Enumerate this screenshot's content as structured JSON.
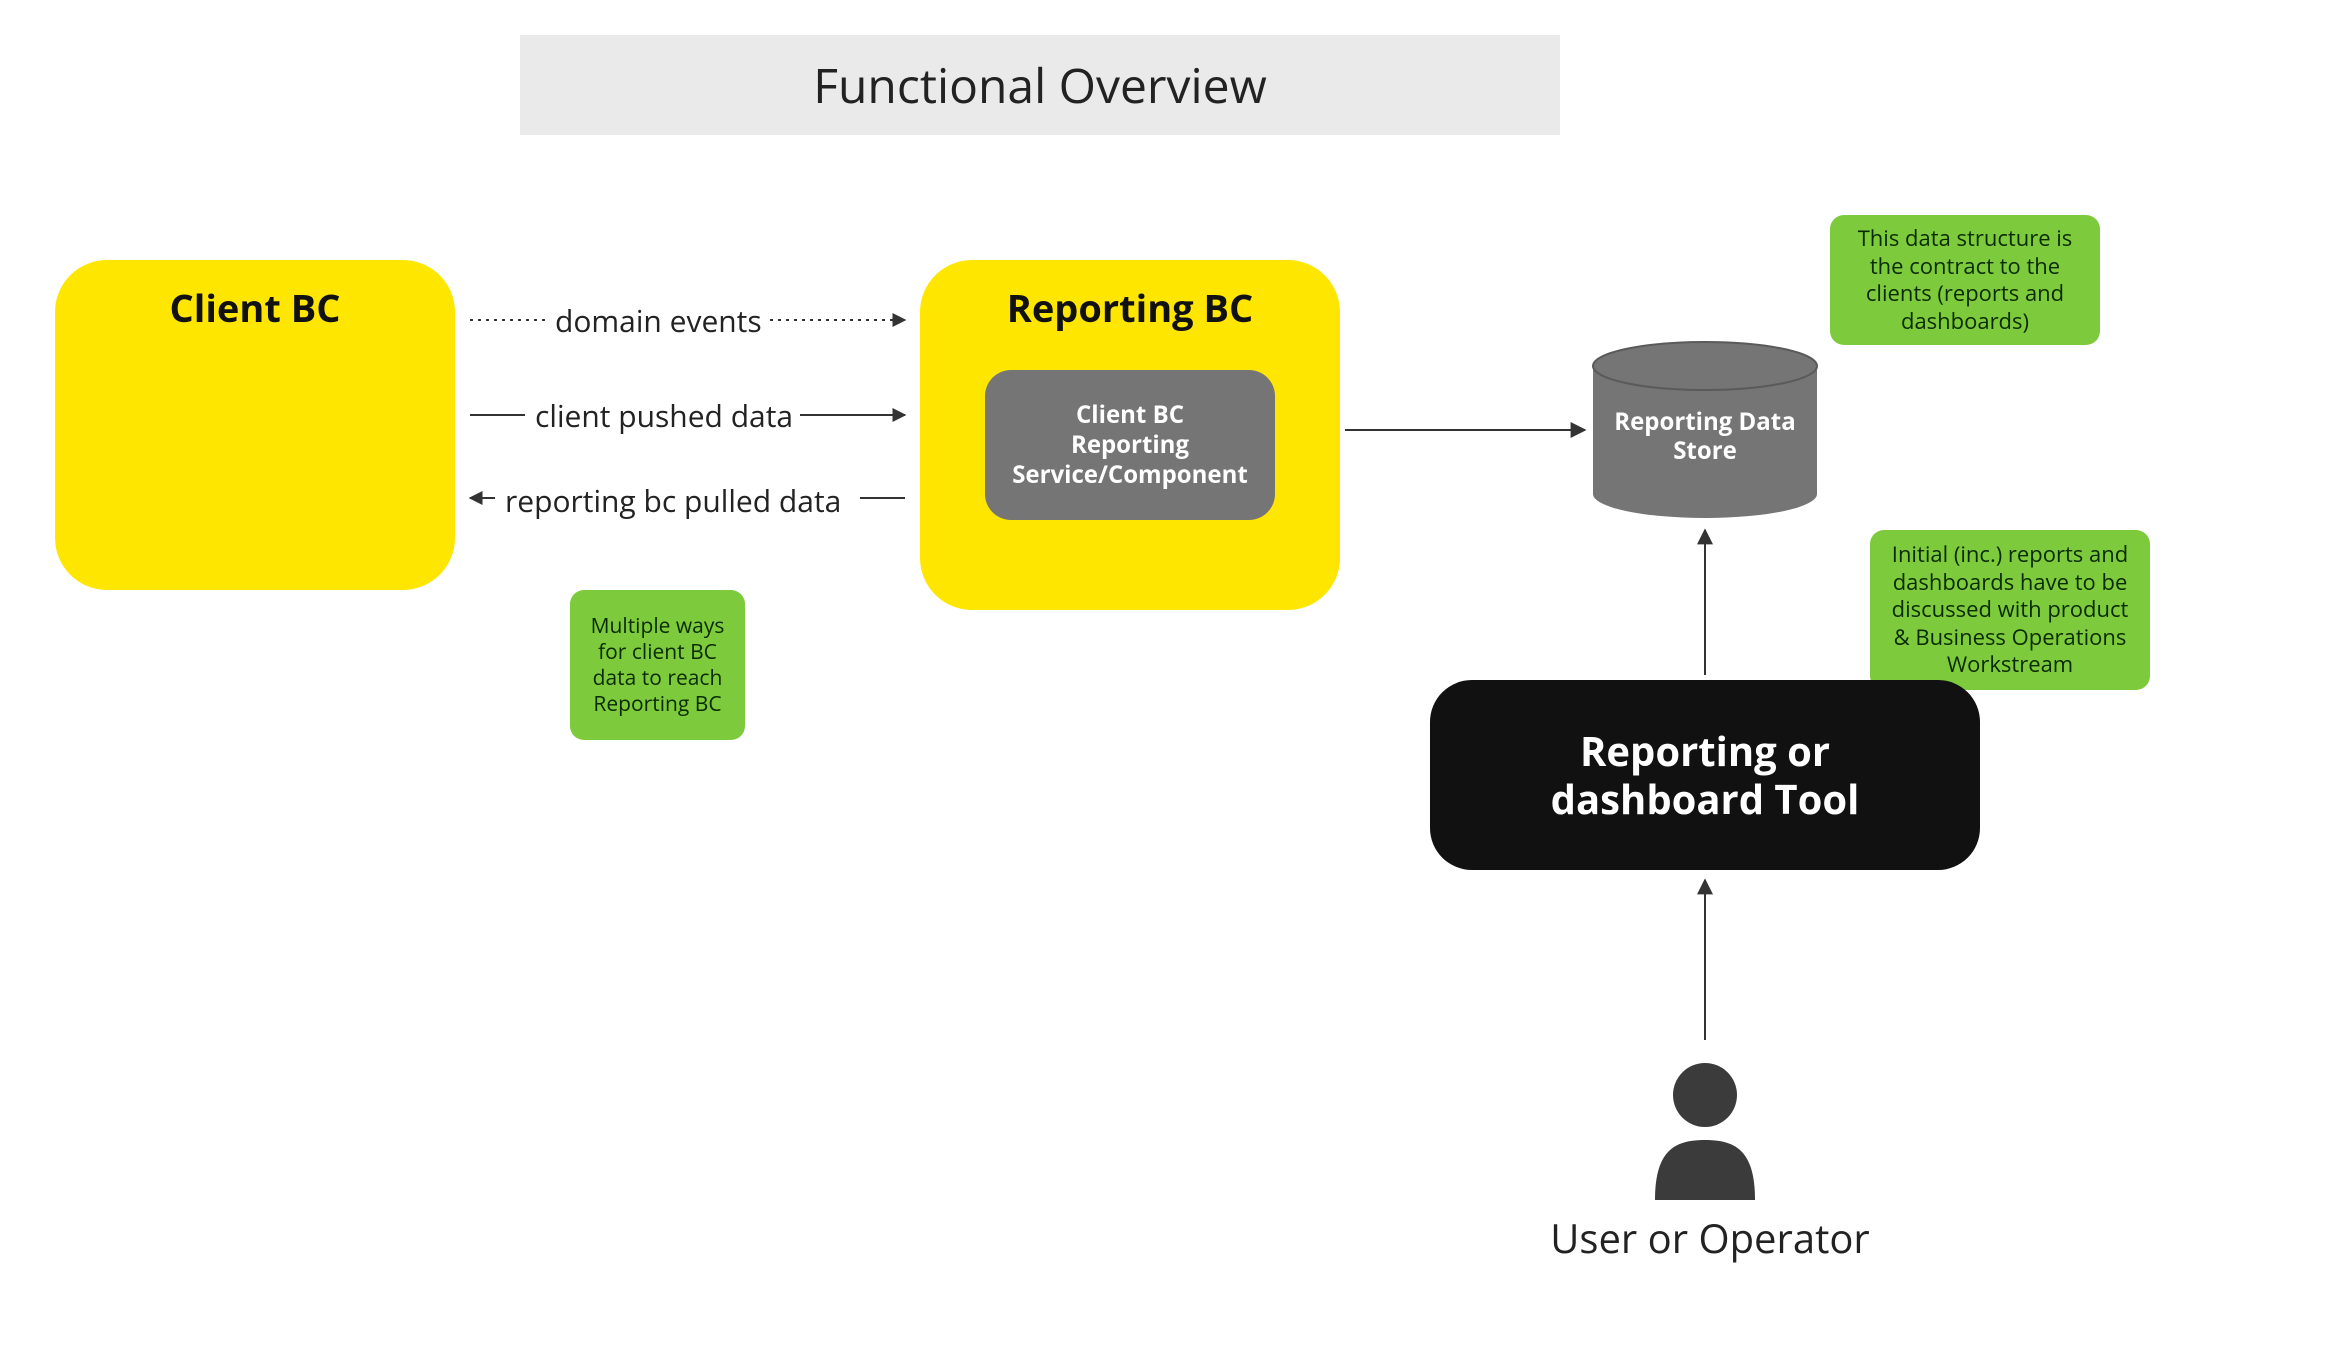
{
  "title": "Functional Overview",
  "boxes": {
    "client_bc": "Client BC",
    "reporting_bc": "Reporting BC",
    "inner_service": "Client BC\nReporting\nService/Component",
    "datastore": "Reporting Data\nStore",
    "tool": "Reporting or dashboard Tool",
    "user_caption": "User or Operator"
  },
  "notes": {
    "ways": "Multiple ways for client BC data to reach Reporting BC",
    "contract": "This data structure is the contract to the clients (reports and dashboards)",
    "initial": "Initial (inc.) reports and dashboards have to be discussed with product & Business Operations Workstream"
  },
  "edges": {
    "domain_events": "domain events",
    "client_pushed": "client pushed data",
    "pulled": "reporting bc pulled data"
  },
  "colors": {
    "bc_fill": "#ffe600",
    "note_fill": "#7dcb3c",
    "gray_fill": "#757575",
    "title_bg": "#eaeaea",
    "black": "#111111"
  }
}
